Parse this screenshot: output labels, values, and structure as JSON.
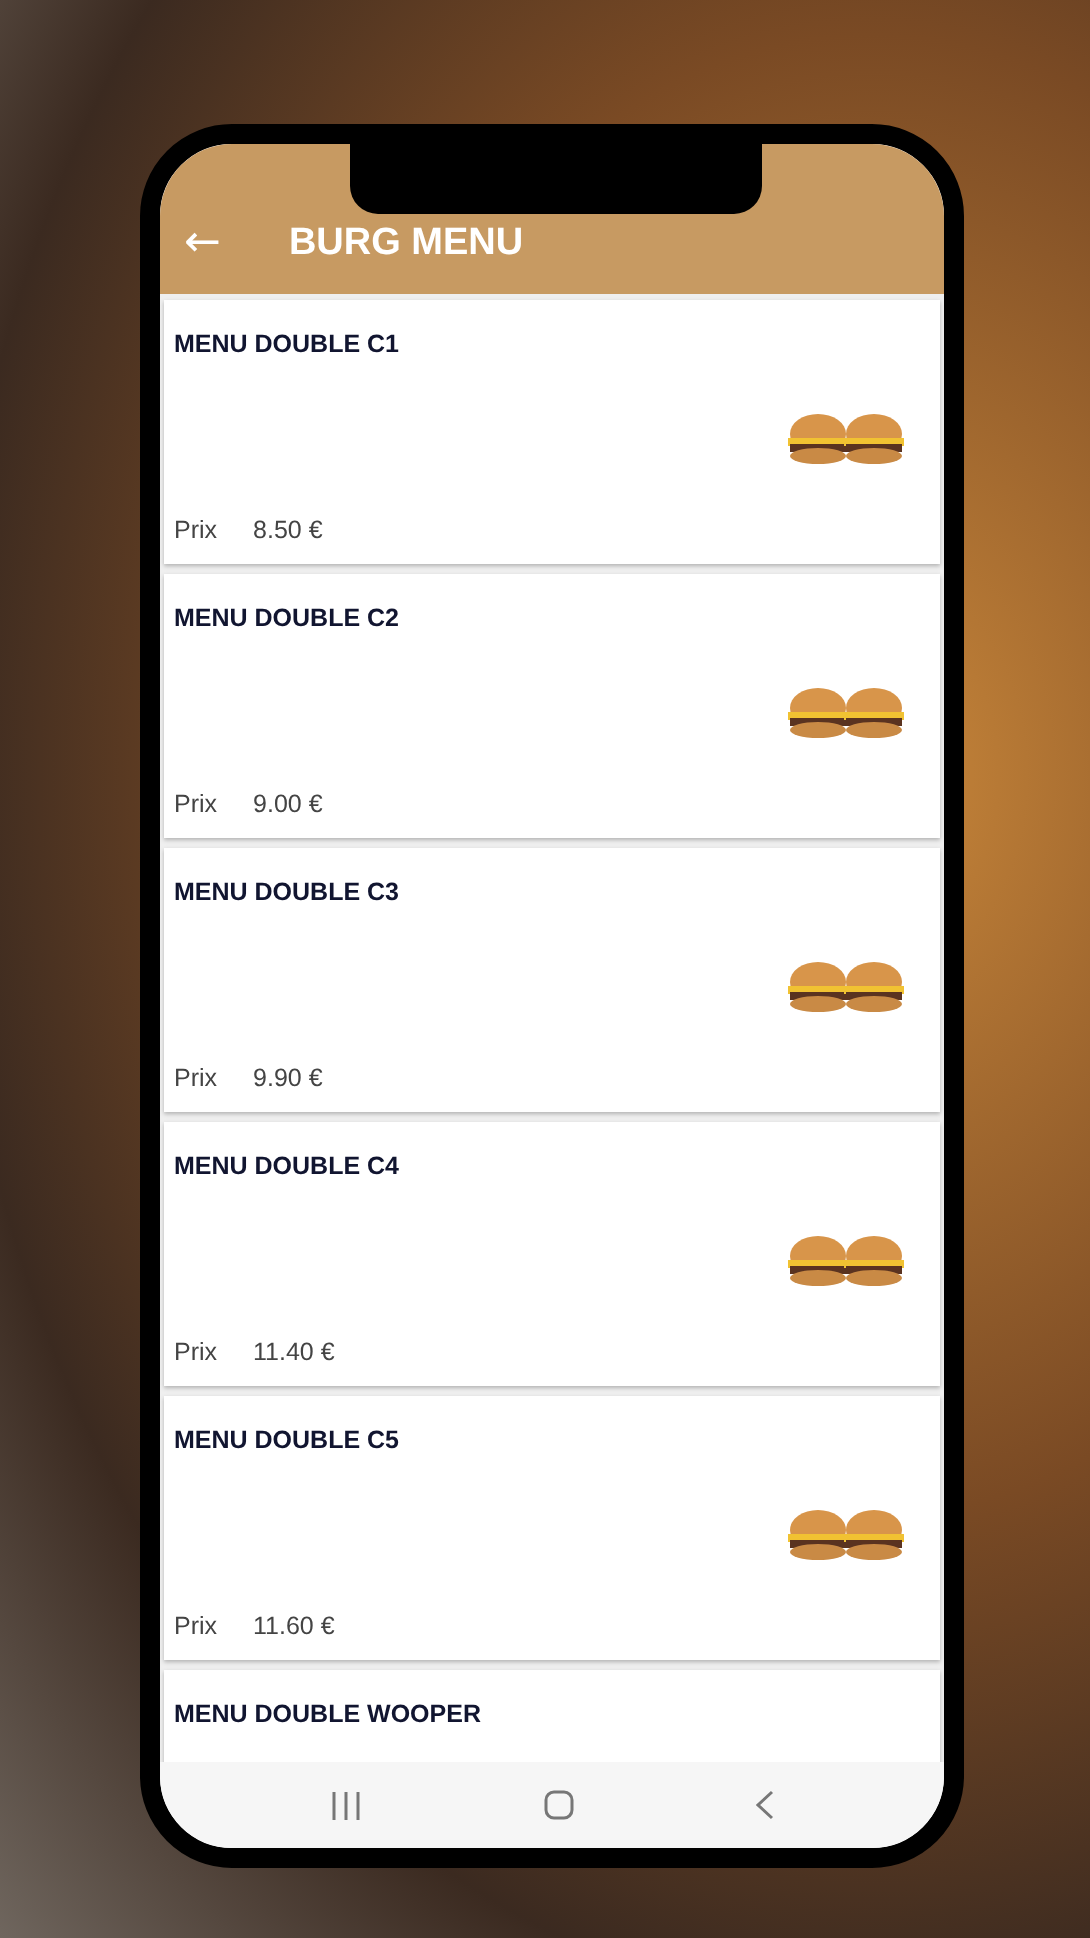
{
  "header": {
    "back_icon": "←",
    "title": "BURG MENU"
  },
  "items": [
    {
      "name": "MENU DOUBLE C1",
      "price_label": "Prix",
      "price": "8.50 €"
    },
    {
      "name": "MENU DOUBLE C2",
      "price_label": "Prix",
      "price": "9.00 €"
    },
    {
      "name": "MENU DOUBLE C3",
      "price_label": "Prix",
      "price": "9.90 €"
    },
    {
      "name": "MENU DOUBLE C4",
      "price_label": "Prix",
      "price": "11.40 €"
    },
    {
      "name": "MENU DOUBLE C5",
      "price_label": "Prix",
      "price": "11.60 €"
    },
    {
      "name": "MENU DOUBLE WOOPER"
    }
  ]
}
